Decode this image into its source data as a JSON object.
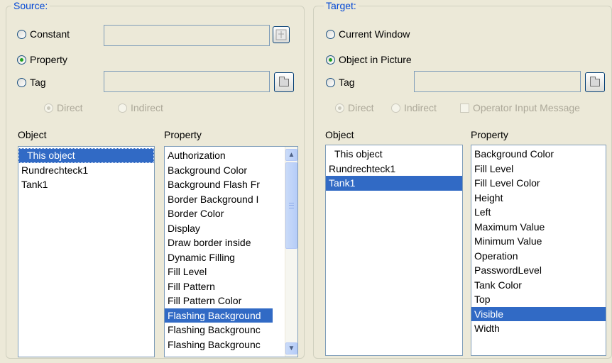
{
  "source": {
    "legend": "Source:",
    "radio_constant": "Constant",
    "radio_property": "Property",
    "radio_tag": "Tag",
    "radio_direct": "Direct",
    "radio_indirect": "Indirect",
    "object_caption": "Object",
    "property_caption": "Property",
    "objects": [
      "This object",
      "Rundrechteck1",
      "Tank1"
    ],
    "properties": [
      "Authorization",
      "Background Color",
      "Background Flash Fr",
      "Border Background I",
      "Border Color",
      "Display",
      "Draw border inside",
      "Dynamic Filling",
      "Fill Level",
      "Fill Pattern",
      "Fill Pattern Color",
      "Flashing Background",
      "Flashing Backgrounc",
      "Flashing Backgrounc"
    ]
  },
  "target": {
    "legend": "Target:",
    "radio_current_window": "Current Window",
    "radio_object_in_picture": "Object in Picture",
    "radio_tag": "Tag",
    "radio_direct": "Direct",
    "radio_indirect": "Indirect",
    "checkbox_operator": "Operator Input Message",
    "object_caption": "Object",
    "property_caption": "Property",
    "objects": [
      "This object",
      "Rundrechteck1",
      "Tank1"
    ],
    "properties": [
      "Background Color",
      "Fill Level",
      "Fill Level Color",
      "Height",
      "Left",
      "Maximum Value",
      "Minimum Value",
      "Operation",
      "PasswordLevel",
      "Tank Color",
      "Top",
      "Visible",
      "Width"
    ]
  },
  "icons": {
    "constant_button": "tag-browse-icon",
    "tag_button": "folder-icon",
    "scroll_up": "▲",
    "scroll_down": "▼"
  },
  "colors": {
    "selection": "#316ac5",
    "legend": "#0046d5",
    "dialog_bg": "#ece9d8"
  }
}
